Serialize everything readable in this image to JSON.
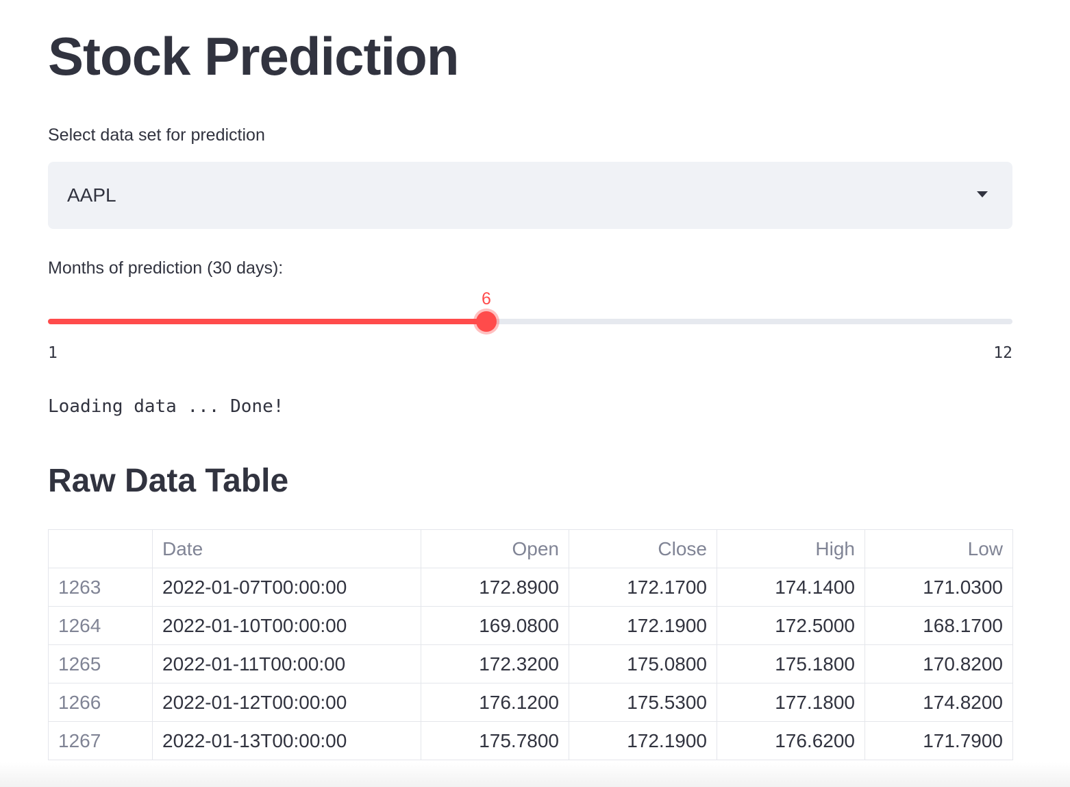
{
  "title": "Stock Prediction",
  "select": {
    "label": "Select data set for prediction",
    "value": "AAPL"
  },
  "slider": {
    "label": "Months of prediction (30 days):",
    "min": 1,
    "max": 12,
    "value": 6,
    "min_label": "1",
    "max_label": "12",
    "value_label": "6",
    "accent_color": "#ff4b4b"
  },
  "status": "Loading data ... Done!",
  "table_section": {
    "title": "Raw Data Table",
    "columns": [
      "",
      "Date",
      "Open",
      "Close",
      "High",
      "Low"
    ],
    "rows": [
      {
        "index": "1263",
        "date": "2022-01-07T00:00:00",
        "open": "172.8900",
        "close": "172.1700",
        "high": "174.1400",
        "low": "171.0300"
      },
      {
        "index": "1264",
        "date": "2022-01-10T00:00:00",
        "open": "169.0800",
        "close": "172.1900",
        "high": "172.5000",
        "low": "168.1700"
      },
      {
        "index": "1265",
        "date": "2022-01-11T00:00:00",
        "open": "172.3200",
        "close": "175.0800",
        "high": "175.1800",
        "low": "170.8200"
      },
      {
        "index": "1266",
        "date": "2022-01-12T00:00:00",
        "open": "176.1200",
        "close": "175.5300",
        "high": "177.1800",
        "low": "174.8200"
      },
      {
        "index": "1267",
        "date": "2022-01-13T00:00:00",
        "open": "175.7800",
        "close": "172.1900",
        "high": "176.6200",
        "low": "171.7900"
      }
    ]
  }
}
